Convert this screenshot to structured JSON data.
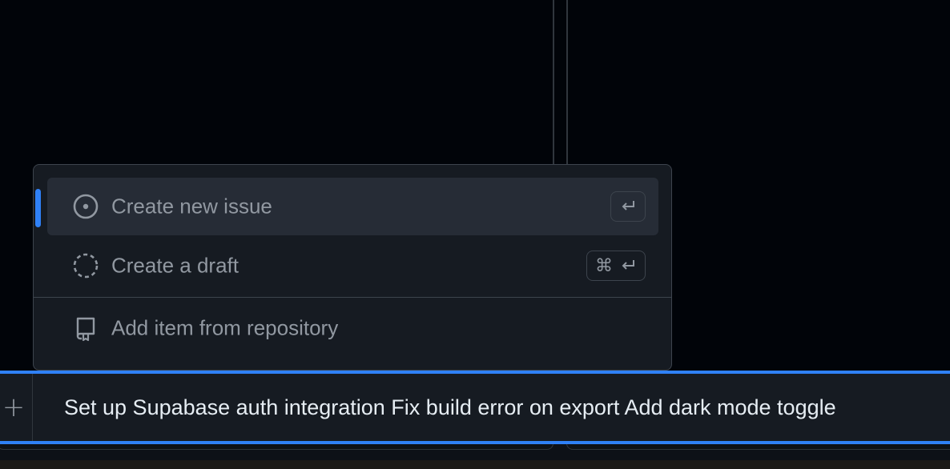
{
  "menu": {
    "items": [
      {
        "label": "Create new issue",
        "icon": "issue-opened-icon",
        "shortcut": "↵"
      },
      {
        "label": "Create a draft",
        "icon": "issue-draft-icon",
        "shortcut_mod": "⌘",
        "shortcut": "↵"
      },
      {
        "label": "Add item from repository",
        "icon": "repo-icon"
      }
    ]
  },
  "add_bar": {
    "plus": "+",
    "value": "Set up Supabase auth integration Fix build error on export Add dark mode toggle"
  },
  "colors": {
    "accent": "#2f81f7",
    "menu_bg": "#161b22",
    "active_bg": "#262c36",
    "page_bg": "#010409"
  }
}
